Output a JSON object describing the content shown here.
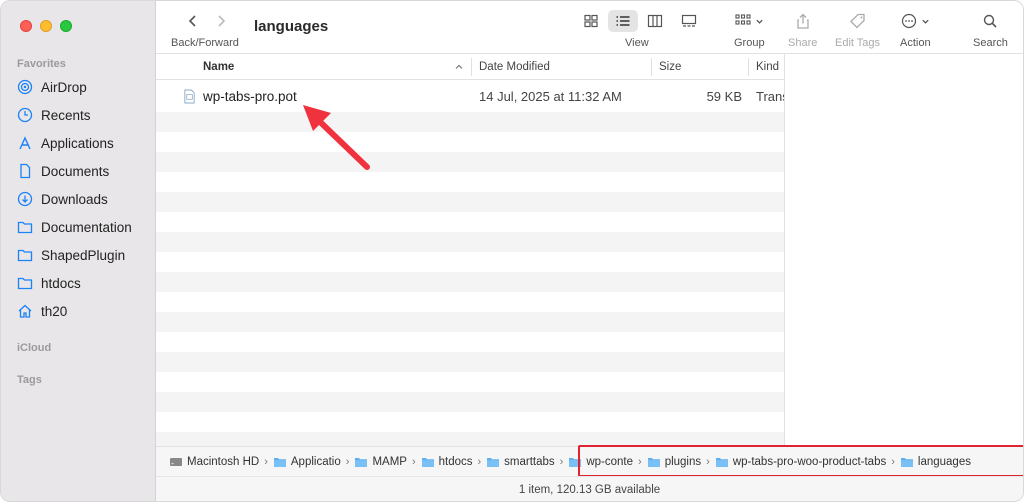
{
  "window": {
    "title": "languages"
  },
  "sidebar": {
    "favorites_label": "Favorites",
    "icloud_label": "iCloud",
    "tags_label": "Tags",
    "items": [
      {
        "label": "AirDrop",
        "icon": "airdrop-icon"
      },
      {
        "label": "Recents",
        "icon": "clock-icon"
      },
      {
        "label": "Applications",
        "icon": "applications-icon"
      },
      {
        "label": "Documents",
        "icon": "document-icon"
      },
      {
        "label": "Downloads",
        "icon": "download-icon"
      },
      {
        "label": "Documentation",
        "icon": "folder-icon"
      },
      {
        "label": "ShapedPlugin",
        "icon": "folder-icon"
      },
      {
        "label": "htdocs",
        "icon": "folder-icon"
      },
      {
        "label": "th20",
        "icon": "home-icon"
      }
    ]
  },
  "toolbar": {
    "nav_label": "Back/Forward",
    "view_label": "View",
    "group_label": "Group",
    "share_label": "Share",
    "edit_tags_label": "Edit Tags",
    "action_label": "Action",
    "search_label": "Search"
  },
  "list": {
    "columns": {
      "name": "Name",
      "date_modified": "Date Modified",
      "size": "Size",
      "kind": "Kind"
    },
    "files": [
      {
        "name": "wp-tabs-pro.pot",
        "date": "14 Jul, 2025 at 11:32 AM",
        "size": "59 KB",
        "kind": "Trans"
      }
    ]
  },
  "pathbar": {
    "crumbs": [
      {
        "label": "Macintosh HD",
        "icon": "disk-icon"
      },
      {
        "label": "Applicatio",
        "icon": "folder-icon"
      },
      {
        "label": "MAMP",
        "icon": "folder-icon"
      },
      {
        "label": "htdocs",
        "icon": "folder-icon"
      },
      {
        "label": "smarttabs",
        "icon": "folder-icon"
      },
      {
        "label": "wp-conte",
        "icon": "folder-icon"
      },
      {
        "label": "plugins",
        "icon": "folder-icon"
      },
      {
        "label": "wp-tabs-pro-woo-product-tabs",
        "icon": "folder-icon"
      },
      {
        "label": "languages",
        "icon": "folder-icon"
      }
    ]
  },
  "status": {
    "text": "1 item, 120.13 GB available"
  },
  "colors": {
    "accent": "#1b82f7",
    "annotation_red": "#e02333"
  }
}
